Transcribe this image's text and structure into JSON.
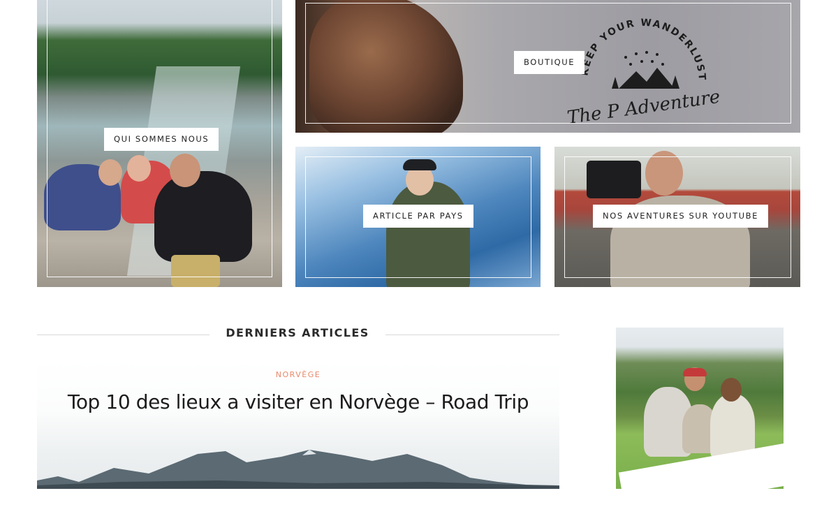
{
  "tiles": {
    "about": {
      "label": "QUI SOMMES NOUS"
    },
    "shop": {
      "label": "BOUTIQUE",
      "embroidery_top": "KEEP YOUR WANDERLUST",
      "embroidery_brand": "The P Adventure"
    },
    "country": {
      "label": "ARTICLE PAR PAYS"
    },
    "youtube": {
      "label": "NOS AVENTURES SUR YOUTUBE"
    }
  },
  "section": {
    "title": "DERNIERS ARTICLES"
  },
  "article": {
    "category": "NORVÈGE",
    "title": "Top 10 des lieux a visiter en Norvège – Road Trip"
  },
  "colors": {
    "accent_category": "#e8896b",
    "text_dark": "#1c1c1c",
    "divider": "#d9d9d9",
    "label_bg": "#ffffff"
  }
}
